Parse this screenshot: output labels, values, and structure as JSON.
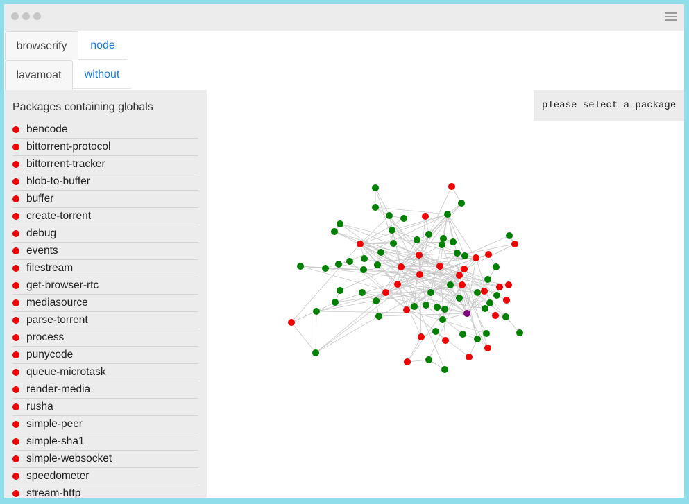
{
  "tabs_row1": [
    {
      "label": "browserify",
      "active": true
    },
    {
      "label": "node",
      "active": false
    }
  ],
  "tabs_row2": [
    {
      "label": "lavamoat",
      "active": true
    },
    {
      "label": "without",
      "active": false
    }
  ],
  "sidebar": {
    "title": "Packages containing globals",
    "items": [
      "bencode",
      "bittorrent-protocol",
      "bittorrent-tracker",
      "blob-to-buffer",
      "buffer",
      "create-torrent",
      "debug",
      "events",
      "filestream",
      "get-browser-rtc",
      "mediasource",
      "parse-torrent",
      "process",
      "punycode",
      "queue-microtask",
      "render-media",
      "rusha",
      "simple-peer",
      "simple-sha1",
      "simple-websocket",
      "speedometer",
      "stream-http"
    ]
  },
  "info_panel": {
    "text": "please select a package"
  },
  "colors": {
    "global": "#f00000",
    "normal": "#008000",
    "selected": "#800080",
    "edge": "#c9c9c9"
  }
}
